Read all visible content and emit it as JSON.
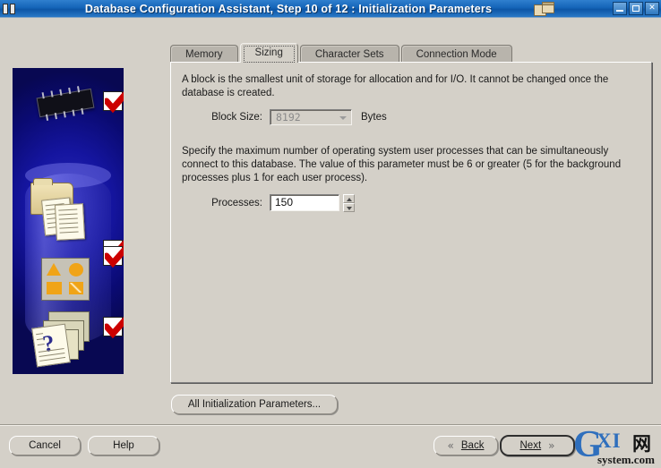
{
  "window": {
    "title": "Database Configuration Assistant, Step 10 of 12 : Initialization Parameters",
    "sysicon": "database-chip-icon",
    "overlay_icon": "stacked-windows-icon",
    "controls": {
      "minimize": "minimize-button",
      "maximize": "maximize-button",
      "close_label": "✕"
    },
    "titlebar_color": "#1565b8"
  },
  "sidebar": {
    "name": "wizard-illustration",
    "background_color": "#0a0a6e",
    "steps": [
      {
        "icon": "memory-chip-icon",
        "checked": true
      },
      {
        "icon": "folder-documents-icon",
        "checked": true
      },
      {
        "icon": "shapes-panel-icon",
        "checked": true
      },
      {
        "icon": "question-document-icon",
        "checked": true
      }
    ],
    "check_color": "#cc0000"
  },
  "tabs": [
    {
      "label": "Memory",
      "selected": false
    },
    {
      "label": "Sizing",
      "selected": true
    },
    {
      "label": "Character Sets",
      "selected": false
    },
    {
      "label": "Connection Mode",
      "selected": false
    }
  ],
  "panel": {
    "block_paragraph": "A block is the smallest unit of storage for allocation and for I/O. It cannot be changed once the database is created.",
    "block_size": {
      "label": "Block Size:",
      "value": "8192",
      "unit": "Bytes",
      "disabled": true
    },
    "processes_paragraph": "Specify the maximum number of operating system user processes that can be simultaneously connect to this database. The value of this parameter must be 6 or greater (5 for the background processes plus 1 for each user process).",
    "processes": {
      "label": "Processes:",
      "value": "150"
    },
    "all_parameters_button": "All Initialization Parameters..."
  },
  "footer": {
    "cancel": "Cancel",
    "help": "Help",
    "back": "Back",
    "back_chevron": "«",
    "next": "Next",
    "next_chevron": "»"
  },
  "watermark": {
    "g": "G",
    "xi": "XI",
    "cn": "网",
    "domain": "system.com"
  }
}
